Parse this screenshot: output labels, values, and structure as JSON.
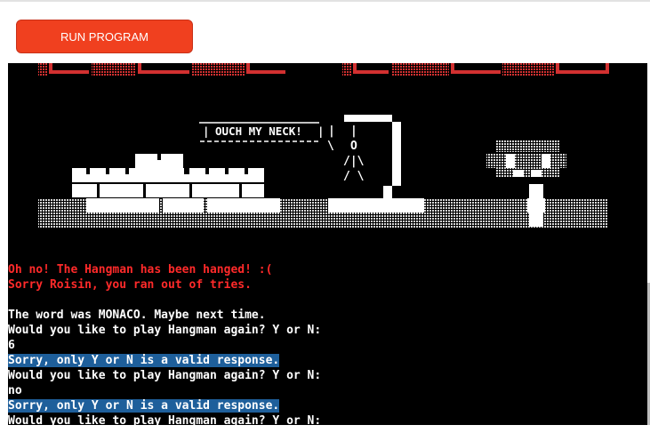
{
  "toolbar": {
    "run_label": "RUN PROGRAM"
  },
  "scene": {
    "sign_text": "OUCH MY NECK!",
    "head": "O",
    "body": "/|\\",
    "legs": "/ \\",
    "rope": "|",
    "rope_slash": "\\"
  },
  "terminal": {
    "lines": [
      {
        "text": "",
        "style": "blank"
      },
      {
        "text": "Oh no! The Hangman has been hanged! :(",
        "style": "red"
      },
      {
        "text": "Sorry Roisin, you ran out of tries.",
        "style": "red"
      },
      {
        "text": "",
        "style": "blank"
      },
      {
        "text": "The word was MONACO. Maybe next time.",
        "style": "normal"
      },
      {
        "text": "Would you like to play Hangman again? Y or N:",
        "style": "normal"
      },
      {
        "text": "6",
        "style": "normal"
      },
      {
        "text": "Sorry, only Y or N is a valid response.",
        "style": "highlight"
      },
      {
        "text": "Would you like to play Hangman again? Y or N:",
        "style": "normal"
      },
      {
        "text": "no",
        "style": "normal"
      },
      {
        "text": "Sorry, only Y or N is a valid response.",
        "style": "highlight"
      },
      {
        "text": "Would you like to play Hangman again? Y or N:",
        "style": "normal"
      }
    ]
  }
}
